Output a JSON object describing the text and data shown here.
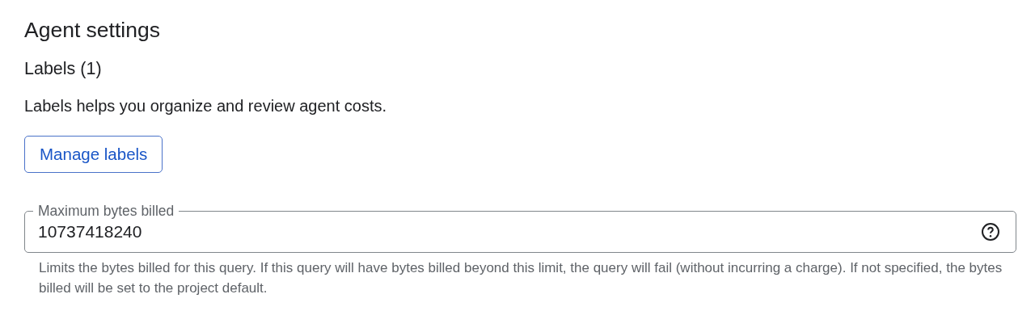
{
  "title": "Agent settings",
  "labels_section": {
    "heading": "Labels (1)",
    "description": "Labels helps you organize and review agent costs.",
    "button": "Manage labels"
  },
  "max_bytes_field": {
    "label": "Maximum bytes billed",
    "value": "10737418240",
    "help_text": "Limits the bytes billed for this query. If this query will have bytes billed beyond this limit, the query will fail (without incurring a charge). If not specified, the bytes billed will be set to the project default."
  }
}
